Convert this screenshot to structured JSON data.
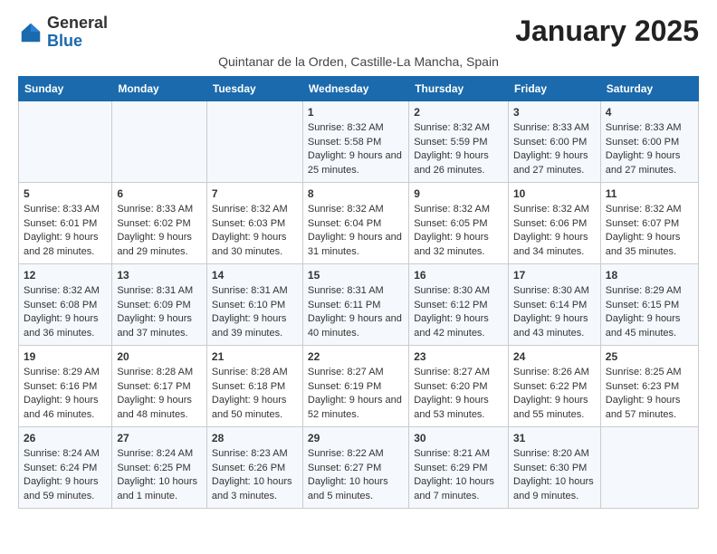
{
  "logo": {
    "general": "General",
    "blue": "Blue"
  },
  "header": {
    "month": "January 2025",
    "location": "Quintanar de la Orden, Castille-La Mancha, Spain"
  },
  "days_of_week": [
    "Sunday",
    "Monday",
    "Tuesday",
    "Wednesday",
    "Thursday",
    "Friday",
    "Saturday"
  ],
  "weeks": [
    [
      {
        "day": "",
        "content": ""
      },
      {
        "day": "",
        "content": ""
      },
      {
        "day": "",
        "content": ""
      },
      {
        "day": "1",
        "content": "Sunrise: 8:32 AM\nSunset: 5:58 PM\nDaylight: 9 hours and 25 minutes."
      },
      {
        "day": "2",
        "content": "Sunrise: 8:32 AM\nSunset: 5:59 PM\nDaylight: 9 hours and 26 minutes."
      },
      {
        "day": "3",
        "content": "Sunrise: 8:33 AM\nSunset: 6:00 PM\nDaylight: 9 hours and 27 minutes."
      },
      {
        "day": "4",
        "content": "Sunrise: 8:33 AM\nSunset: 6:00 PM\nDaylight: 9 hours and 27 minutes."
      }
    ],
    [
      {
        "day": "5",
        "content": "Sunrise: 8:33 AM\nSunset: 6:01 PM\nDaylight: 9 hours and 28 minutes."
      },
      {
        "day": "6",
        "content": "Sunrise: 8:33 AM\nSunset: 6:02 PM\nDaylight: 9 hours and 29 minutes."
      },
      {
        "day": "7",
        "content": "Sunrise: 8:32 AM\nSunset: 6:03 PM\nDaylight: 9 hours and 30 minutes."
      },
      {
        "day": "8",
        "content": "Sunrise: 8:32 AM\nSunset: 6:04 PM\nDaylight: 9 hours and 31 minutes."
      },
      {
        "day": "9",
        "content": "Sunrise: 8:32 AM\nSunset: 6:05 PM\nDaylight: 9 hours and 32 minutes."
      },
      {
        "day": "10",
        "content": "Sunrise: 8:32 AM\nSunset: 6:06 PM\nDaylight: 9 hours and 34 minutes."
      },
      {
        "day": "11",
        "content": "Sunrise: 8:32 AM\nSunset: 6:07 PM\nDaylight: 9 hours and 35 minutes."
      }
    ],
    [
      {
        "day": "12",
        "content": "Sunrise: 8:32 AM\nSunset: 6:08 PM\nDaylight: 9 hours and 36 minutes."
      },
      {
        "day": "13",
        "content": "Sunrise: 8:31 AM\nSunset: 6:09 PM\nDaylight: 9 hours and 37 minutes."
      },
      {
        "day": "14",
        "content": "Sunrise: 8:31 AM\nSunset: 6:10 PM\nDaylight: 9 hours and 39 minutes."
      },
      {
        "day": "15",
        "content": "Sunrise: 8:31 AM\nSunset: 6:11 PM\nDaylight: 9 hours and 40 minutes."
      },
      {
        "day": "16",
        "content": "Sunrise: 8:30 AM\nSunset: 6:12 PM\nDaylight: 9 hours and 42 minutes."
      },
      {
        "day": "17",
        "content": "Sunrise: 8:30 AM\nSunset: 6:14 PM\nDaylight: 9 hours and 43 minutes."
      },
      {
        "day": "18",
        "content": "Sunrise: 8:29 AM\nSunset: 6:15 PM\nDaylight: 9 hours and 45 minutes."
      }
    ],
    [
      {
        "day": "19",
        "content": "Sunrise: 8:29 AM\nSunset: 6:16 PM\nDaylight: 9 hours and 46 minutes."
      },
      {
        "day": "20",
        "content": "Sunrise: 8:28 AM\nSunset: 6:17 PM\nDaylight: 9 hours and 48 minutes."
      },
      {
        "day": "21",
        "content": "Sunrise: 8:28 AM\nSunset: 6:18 PM\nDaylight: 9 hours and 50 minutes."
      },
      {
        "day": "22",
        "content": "Sunrise: 8:27 AM\nSunset: 6:19 PM\nDaylight: 9 hours and 52 minutes."
      },
      {
        "day": "23",
        "content": "Sunrise: 8:27 AM\nSunset: 6:20 PM\nDaylight: 9 hours and 53 minutes."
      },
      {
        "day": "24",
        "content": "Sunrise: 8:26 AM\nSunset: 6:22 PM\nDaylight: 9 hours and 55 minutes."
      },
      {
        "day": "25",
        "content": "Sunrise: 8:25 AM\nSunset: 6:23 PM\nDaylight: 9 hours and 57 minutes."
      }
    ],
    [
      {
        "day": "26",
        "content": "Sunrise: 8:24 AM\nSunset: 6:24 PM\nDaylight: 9 hours and 59 minutes."
      },
      {
        "day": "27",
        "content": "Sunrise: 8:24 AM\nSunset: 6:25 PM\nDaylight: 10 hours and 1 minute."
      },
      {
        "day": "28",
        "content": "Sunrise: 8:23 AM\nSunset: 6:26 PM\nDaylight: 10 hours and 3 minutes."
      },
      {
        "day": "29",
        "content": "Sunrise: 8:22 AM\nSunset: 6:27 PM\nDaylight: 10 hours and 5 minutes."
      },
      {
        "day": "30",
        "content": "Sunrise: 8:21 AM\nSunset: 6:29 PM\nDaylight: 10 hours and 7 minutes."
      },
      {
        "day": "31",
        "content": "Sunrise: 8:20 AM\nSunset: 6:30 PM\nDaylight: 10 hours and 9 minutes."
      },
      {
        "day": "",
        "content": ""
      }
    ]
  ]
}
